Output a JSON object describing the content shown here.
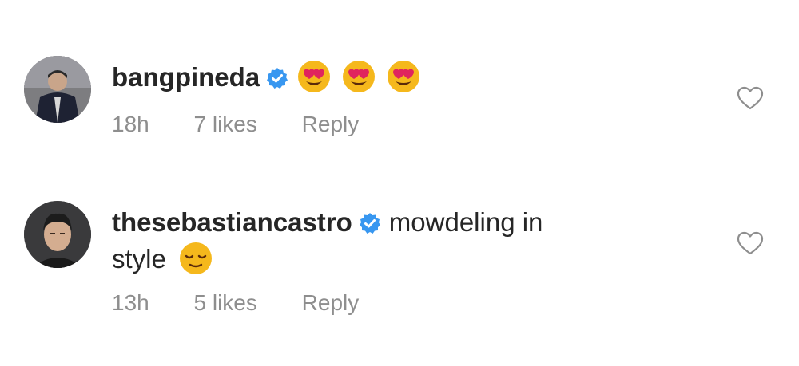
{
  "comments": [
    {
      "username": "bangpineda",
      "verified": true,
      "text": "",
      "emojis": [
        "heart-eyes-emoji",
        "heart-eyes-emoji",
        "heart-eyes-emoji"
      ],
      "time": "18h",
      "likes": "7 likes",
      "reply": "Reply",
      "like_icon": "heart-outline-icon"
    },
    {
      "username": "thesebastiancastro",
      "verified": true,
      "text_line1": "mowdeling in",
      "text_line2": "style",
      "emojis": [
        "relieved-face-emoji"
      ],
      "time": "13h",
      "likes": "5 likes",
      "reply": "Reply",
      "like_icon": "heart-outline-icon"
    }
  ],
  "colors": {
    "text": "#262626",
    "meta": "#8e8e8e",
    "verified": "#3897f0",
    "emoji": "#f5b81c",
    "heart_emoji": "#e0245e",
    "background": "#ffffff"
  }
}
